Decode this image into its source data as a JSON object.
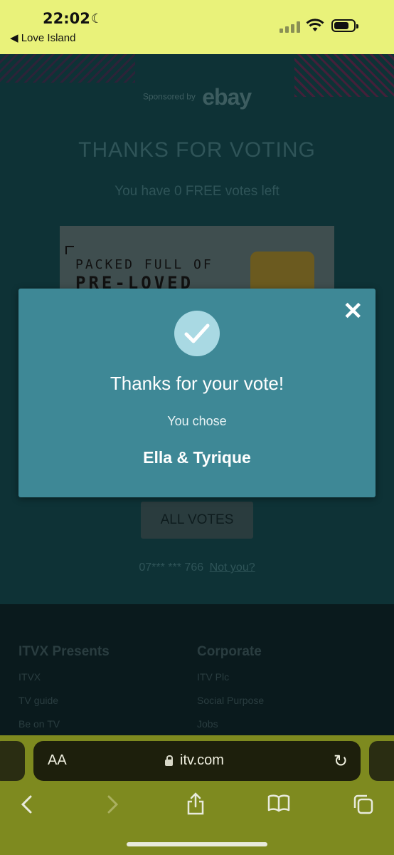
{
  "status_bar": {
    "time": "22:02",
    "back_app": "◀ Love Island"
  },
  "page": {
    "sponsored_prefix": "Sponsored by",
    "sponsor": "ebay",
    "title": "THANKS FOR VOTING",
    "free_votes": "You have 0 FREE votes left",
    "ad": {
      "line1": "PACKED FULL OF",
      "line2": "PRE-LOVED"
    },
    "all_votes_label": "ALL VOTES",
    "phone_masked": "07*** *** 766",
    "not_you": "Not you?"
  },
  "footer": {
    "columns": [
      {
        "heading": "ITVX Presents",
        "links": [
          "ITVX",
          "TV guide",
          "Be on TV"
        ]
      },
      {
        "heading": "Corporate",
        "links": [
          "ITV Plc",
          "Social Purpose",
          "Jobs"
        ]
      }
    ]
  },
  "modal": {
    "title": "Thanks for your vote!",
    "subtitle": "You chose",
    "choice": "Ella & Tyrique",
    "close_icon": "close-icon",
    "check_icon": "check-icon"
  },
  "browser": {
    "text_size": "AA",
    "url": "itv.com"
  },
  "colors": {
    "status_bar_bg": "#e9f27a",
    "modal_bg": "#3e8896",
    "page_bg": "#0e3236",
    "browser_bg": "#7e8a1f"
  }
}
